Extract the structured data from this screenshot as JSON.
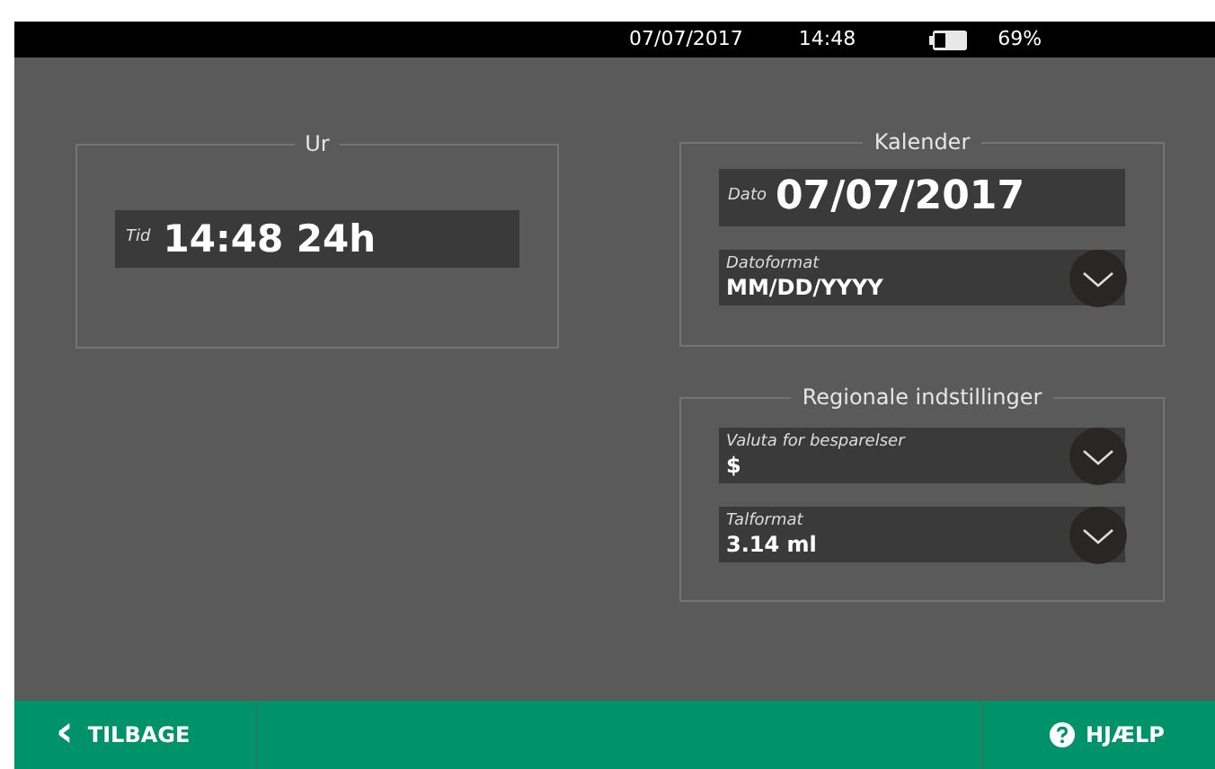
{
  "status_bar": {
    "date": "07/07/2017",
    "time": "14:48",
    "battery": "69%"
  },
  "clock": {
    "title": "Ur",
    "field": {
      "label": "Tid",
      "value": "14:48 24h"
    }
  },
  "calendar": {
    "title": "Kalender",
    "date_field": {
      "label": "Dato",
      "value": "07/07/2017"
    },
    "format_field": {
      "label": "Datoformat",
      "value": "MM/DD/YYYY"
    }
  },
  "regional": {
    "title": "Regionale indstillinger",
    "fields": [
      {
        "label": "Valuta for besparelser",
        "value": "$"
      },
      {
        "label": "Talformat",
        "value": "3.14 ml"
      }
    ]
  },
  "footer": {
    "back": {
      "icon": "‹",
      "label": "TILBAGE"
    },
    "help": {
      "label": "HJÆLP"
    }
  }
}
